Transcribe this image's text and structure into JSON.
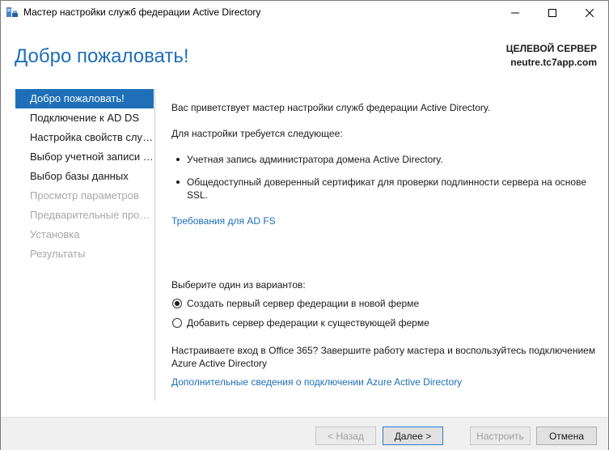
{
  "window": {
    "title": "Мастер настройки служб федерации Active Directory",
    "icon": "adfs-icon"
  },
  "header": {
    "page_title": "Добро пожаловать!",
    "target_label": "ЦЕЛЕВОЙ СЕРВЕР",
    "target_host": "neutre.tc7app.com",
    "accent_color": "#1e6fb8"
  },
  "nav": {
    "items": [
      {
        "label": "Добро пожаловать!",
        "state": "active"
      },
      {
        "label": "Подключение к AD DS",
        "state": "enabled"
      },
      {
        "label": "Настройка свойств служ...",
        "state": "enabled"
      },
      {
        "label": "Выбор учетной записи с...",
        "state": "enabled"
      },
      {
        "label": "Выбор базы данных",
        "state": "enabled"
      },
      {
        "label": "Просмотр параметров",
        "state": "disabled"
      },
      {
        "label": "Предварительные прове...",
        "state": "disabled"
      },
      {
        "label": "Установка",
        "state": "disabled"
      },
      {
        "label": "Результаты",
        "state": "disabled"
      }
    ]
  },
  "content": {
    "welcome": "Вас приветствует мастер настройки служб федерации Active Directory.",
    "requirements_intro": "Для настройки требуется следующее:",
    "bullets": [
      "Учетная запись администратора домена Active Directory.",
      "Общедоступный доверенный сертификат для проверки подлинности сервера на основе SSL."
    ],
    "requirements_link": "Требования для AD FS",
    "choose_prompt": "Выберите один из вариантов:",
    "options": [
      {
        "label": "Создать первый сервер федерации в новой ферме",
        "checked": true
      },
      {
        "label": "Добавить сервер федерации к существующей ферме",
        "checked": false
      }
    ],
    "office_note": "Настраиваете вход в Office 365? Завершите работу мастера и воспользуйтесь подключением Azure Active Directory",
    "azure_link": "Дополнительные сведения о подключении Azure Active Directory"
  },
  "footer": {
    "back": "< Назад",
    "next": "Далее >",
    "configure": "Настроить",
    "cancel": "Отмена"
  }
}
